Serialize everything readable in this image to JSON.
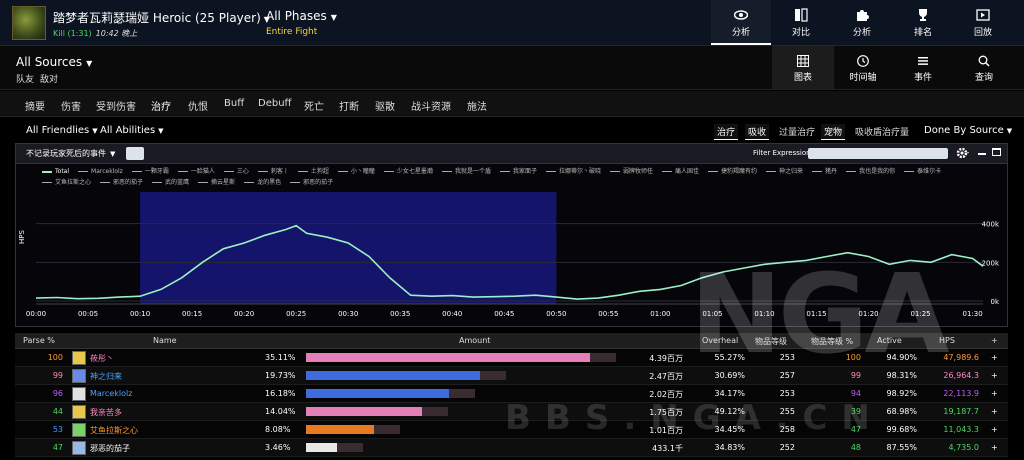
{
  "header": {
    "boss_title": "踏梦者瓦莉瑟瑞娅 Heroic (25 Player)",
    "kill_text": "Kill (1:31)",
    "kill_time": "10:42 晚上",
    "phases": "All Phases",
    "phase_sub": "Entire Fight",
    "nav": [
      "分析",
      "对比",
      "分析",
      "排名",
      "回放"
    ]
  },
  "subheader": {
    "source": "All Sources",
    "sub1": "队友",
    "sub2": "敌对",
    "views": [
      "图表",
      "时间轴",
      "事件",
      "查询"
    ]
  },
  "tabs": [
    "摘要",
    "伤害",
    "受到伤害",
    "治疗",
    "仇恨",
    "Buff",
    "Debuff",
    "死亡",
    "打断",
    "驱散",
    "战斗资源",
    "施法"
  ],
  "filters": {
    "friendlies": "All Friendlies",
    "abilities": "All Abilities",
    "chips": [
      "治疗",
      "吸收",
      "过量治疗",
      "宠物",
      "吸收盾治疗量"
    ],
    "done_by": "Done By Source"
  },
  "graph": {
    "option": "不记录玩家死后的事件",
    "filter_label": "Filter Expression:",
    "legend": [
      "Total",
      "Marceklolz",
      "一颗牙霸",
      "一脸猫人",
      "三心",
      "刺客丨",
      "土狗超",
      "小丶瞳瞳",
      "少女七星墨瀚",
      "我就是一个盾",
      "我家面子",
      "拉娜蒂尔丶破晓",
      "弱牌牧师任",
      "痛人国佳",
      "捷豹羯魔有约",
      "神之归来",
      "猪丹",
      "我也是我的你",
      "泰维尔卡",
      "艾鱼拉斯之心",
      "邪恶的茄子",
      "武的蓝鹰",
      "摘云星斯",
      "龙的黑色",
      "邪恶的茄子"
    ],
    "ylabel": "HPS",
    "y_ticks": [
      "400k",
      "200k",
      "0k"
    ],
    "x_ticks": [
      "00:00",
      "00:05",
      "00:10",
      "00:15",
      "00:20",
      "00:25",
      "00:30",
      "00:35",
      "00:40",
      "00:45",
      "00:50",
      "00:55",
      "01:00",
      "01:05",
      "01:10",
      "01:15",
      "01:20",
      "01:25",
      "01:30"
    ]
  },
  "chart_data": {
    "type": "line",
    "title": "",
    "xlabel": "",
    "ylabel": "HPS",
    "ylim": [
      0,
      450000
    ],
    "x": [
      0,
      2,
      4,
      6,
      8,
      10,
      12,
      14,
      16,
      18,
      20,
      22,
      24,
      25,
      26,
      28,
      30,
      32,
      34,
      36,
      38,
      40,
      42,
      44,
      46,
      48,
      50,
      52,
      54,
      56,
      58,
      60,
      62,
      64,
      66,
      68,
      70,
      72,
      74,
      76,
      78,
      80,
      82,
      84,
      86,
      88,
      90,
      91
    ],
    "series": [
      {
        "name": "Total",
        "values": [
          15000,
          18000,
          12000,
          14000,
          20000,
          25000,
          60000,
          120000,
          200000,
          270000,
          300000,
          340000,
          370000,
          390000,
          350000,
          330000,
          300000,
          230000,
          120000,
          30000,
          25000,
          28000,
          20000,
          22000,
          25000,
          30000,
          20000,
          10000,
          15000,
          30000,
          50000,
          60000,
          80000,
          120000,
          150000,
          170000,
          190000,
          200000,
          210000,
          230000,
          250000,
          230000,
          190000,
          210000,
          200000,
          240000,
          220000,
          180000
        ]
      }
    ],
    "highlight_range": [
      10,
      50
    ]
  },
  "table": {
    "headers": [
      "Parse %",
      "Name",
      "Amount",
      "Overheal",
      "物品等级",
      "物品等级 %",
      "Active",
      "HPS",
      "+"
    ],
    "rows": [
      {
        "parse": "100",
        "parse_color": "#ff9a2e",
        "name": "莜彤丶",
        "name_color": "#ff8ac2",
        "icon": "#e8c84a",
        "pct": "35.11%",
        "bar": 0.9172,
        "bar_color": "#e57fb8",
        "amount": "4.39百万",
        "overheal": "55.27%",
        "ilvl": "253",
        "ilvl_pct": "100",
        "ilvl_pct_color": "#ff9a2e",
        "active": "94.90%",
        "hps": "47,989.6",
        "hps_color": "#ff9a2e"
      },
      {
        "parse": "99",
        "parse_color": "#ff8ac2",
        "name": "神之归来",
        "name_color": "#4aa3ff",
        "icon": "#6a8ae8",
        "pct": "19.73%",
        "bar": 0.56,
        "bar_color": "#3e6be0",
        "amount": "2.47百万",
        "overheal": "30.69%",
        "ilvl": "257",
        "ilvl_pct": "99",
        "ilvl_pct_color": "#ff8ac2",
        "active": "98.31%",
        "hps": "26,964.3",
        "hps_color": "#ff8ac2"
      },
      {
        "parse": "96",
        "parse_color": "#c05bff",
        "name": "Marceklolz",
        "name_color": "#4aa3ff",
        "icon": "#e0e0e0",
        "pct": "16.18%",
        "bar": 0.46,
        "bar_color": "#3e6be0",
        "amount": "2.02百万",
        "overheal": "34.17%",
        "ilvl": "253",
        "ilvl_pct": "94",
        "ilvl_pct_color": "#c05bff",
        "active": "98.92%",
        "hps": "22,113.9",
        "hps_color": "#c05bff"
      },
      {
        "parse": "44",
        "parse_color": "#4cd964",
        "name": "我亲苦多",
        "name_color": "#ff8ac2",
        "icon": "#e8c84a",
        "pct": "14.04%",
        "bar": 0.375,
        "bar_color": "#e57fb8",
        "amount": "1.75百万",
        "overheal": "49.12%",
        "ilvl": "255",
        "ilvl_pct": "39",
        "ilvl_pct_color": "#4cd964",
        "active": "68.98%",
        "hps": "19,187.7",
        "hps_color": "#4cd964"
      },
      {
        "parse": "53",
        "parse_color": "#4a9bff",
        "name": "艾鱼拉斯之心",
        "name_color": "#ff9a2e",
        "icon": "#7ad16a",
        "pct": "8.08%",
        "bar": 0.22,
        "bar_color": "#e87a22",
        "amount": "1.01百万",
        "overheal": "34.45%",
        "ilvl": "258",
        "ilvl_pct": "47",
        "ilvl_pct_color": "#4cd964",
        "active": "99.68%",
        "hps": "11,043.3",
        "hps_color": "#4cd964"
      },
      {
        "parse": "47",
        "parse_color": "#4cd964",
        "name": "邪恶的茄子",
        "name_color": "#ffffff",
        "icon": "#9ab8e0",
        "pct": "3.46%",
        "bar": 0.1,
        "bar_color": "#e8e8e8",
        "amount": "433.1千",
        "overheal": "34.83%",
        "ilvl": "252",
        "ilvl_pct": "48",
        "ilvl_pct_color": "#4cd964",
        "active": "87.55%",
        "hps": "4,735.0",
        "hps_color": "#4cd964"
      }
    ]
  },
  "watermark": {
    "logo": "NGA",
    "sub": "BBS.NGA.CN"
  }
}
